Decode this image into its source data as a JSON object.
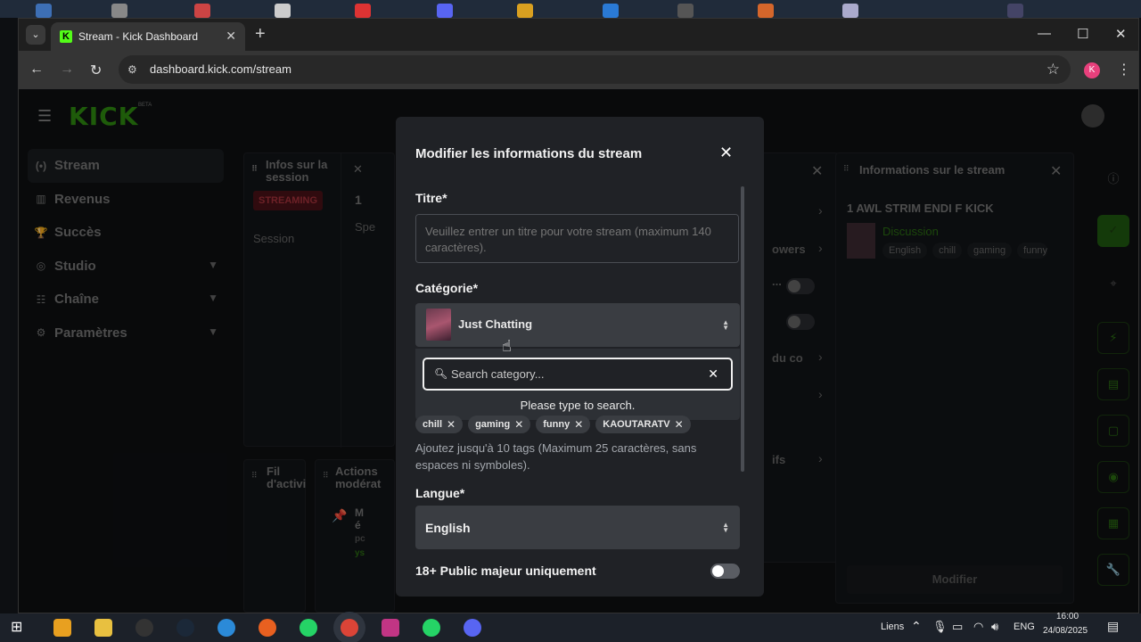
{
  "browser": {
    "tab_title": "Stream - Kick Dashboard",
    "url": "dashboard.kick.com/stream",
    "profile_initial": "K"
  },
  "dashboard": {
    "logo": "KICK",
    "logo_badge": "BETA",
    "sidebar": [
      {
        "label": "Stream",
        "icon": "(•)"
      },
      {
        "label": "Revenus",
        "icon": "▥"
      },
      {
        "label": "Succès",
        "icon": "🏆"
      },
      {
        "label": "Studio",
        "icon": "◎"
      },
      {
        "label": "Chaîne",
        "icon": "☷"
      },
      {
        "label": "Paramètres",
        "icon": "⚙"
      }
    ],
    "session_panel": {
      "title_line1": "Infos sur la",
      "title_line2": "session",
      "badge": "STREAMING",
      "session_label": "Session",
      "count": "1",
      "spec": "Spe"
    },
    "mid_panel": {
      "row1": "owers",
      "row2": "...",
      "row3": "du co",
      "row4": "ifs"
    },
    "activity_panel": {
      "title_line1": "Fil",
      "title_line2": "d'activi"
    },
    "mod_panel": {
      "title_line1": "Actions",
      "title_line2": "modérat",
      "line1": "M",
      "line2": "é",
      "line3": "pc",
      "line4": "ys"
    },
    "info_panel": {
      "title": "Informations sur le stream",
      "stream_title": "1 AWL STRIM ENDI F KICK",
      "category": "Discussion",
      "tags": [
        "English",
        "chill",
        "gaming",
        "funny"
      ],
      "button": "Modifier"
    }
  },
  "modal": {
    "title": "Modifier les informations du stream",
    "title_field_label": "Titre*",
    "title_placeholder": "Veuillez entrer un titre pour votre stream (maximum 140 caractères).",
    "category_label": "Catégorie*",
    "category_value": "Just Chatting",
    "search_placeholder": "Search category...",
    "search_hint": "Please type to search.",
    "tags": [
      "chill",
      "gaming",
      "funny",
      "KAOUTARATV"
    ],
    "tags_helper": "Ajoutez jusqu'à 10 tags (Maximum 25 caractères, sans espaces ni symboles).",
    "language_label": "Langue*",
    "language_value": "English",
    "adult_label": "18+ Public majeur uniquement"
  },
  "taskbar": {
    "links": "Liens",
    "lang": "ENG",
    "time": "16:00",
    "date": "24/08/2025"
  },
  "colors": {
    "kick_green": "#53fc18",
    "modal_bg": "#202226",
    "select_bg": "#3a3d42"
  }
}
